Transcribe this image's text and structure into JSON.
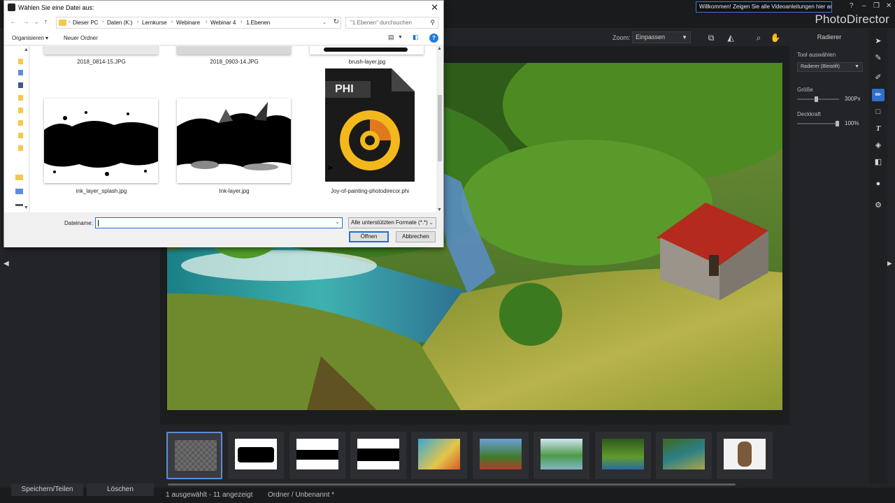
{
  "app": {
    "brand": "PhotoDirector",
    "notice": "Willkommen! Zeigen Sie alle Videoanleitungen hier an!",
    "window_controls": [
      "?",
      "–",
      "❐",
      "✕"
    ]
  },
  "toolbar": {
    "zoom_label": "Zoom:",
    "zoom_value": "Einpassen"
  },
  "right_panel": {
    "title": "Radierer",
    "tool_label": "Tool auswählen",
    "tool_value": "Radierer (Bleistift)",
    "size_label": "Größe",
    "size_value": "300Px",
    "size_level": 0.45,
    "opacity_label": "Deckkraft",
    "opacity_value": "100%",
    "opacity_level": 1.0
  },
  "tools": [
    "select-tool",
    "brush-tool",
    "pen-tool",
    "eraser-tool",
    "rect-tool",
    "text-tool",
    "fill-tool",
    "gradient-tool",
    "drop-tool",
    "settings-tool"
  ],
  "filmstrip": {
    "thumbs": [
      "transparent",
      "ink-splash",
      "ink-layer-1",
      "ink-layer-2",
      "comic",
      "church",
      "lake",
      "river",
      "painting",
      "figure"
    ]
  },
  "bottom": {
    "save_share": "Speichern/Teilen",
    "delete": "Löschen",
    "status": "1 ausgewählt - 11 angezeigt",
    "folder": "Ordner / Unbenannt *"
  },
  "dialog": {
    "title": "Wählen Sie eine Datei aus:",
    "breadcrumbs": [
      "Dieser PC",
      "Daten (K:)",
      "Lernkurse",
      "Webinare",
      "Webinar 4",
      "1.Ebenen"
    ],
    "search_placeholder": "\"1.Ebenen\" durchsuchen",
    "organize": "Organisieren ▾",
    "new_folder": "Neuer Ordner",
    "files_top": [
      "2018_0814-15.JPG",
      "2018_0903-14.JPG",
      "brush-layer.jpg"
    ],
    "files": [
      {
        "name": "ink_layer_splash.jpg",
        "kind": "splash"
      },
      {
        "name": "Ink-layer.jpg",
        "kind": "ink"
      },
      {
        "name": "Joy-of-painting-photodirecor.phi",
        "kind": "phi"
      }
    ],
    "phi_badge": "PHI",
    "filename_label": "Dateiname:",
    "filename_value": "",
    "filetype": "Alle unterstützten Formate (*.*)",
    "open": "Öffnen",
    "cancel": "Abbrechen"
  }
}
